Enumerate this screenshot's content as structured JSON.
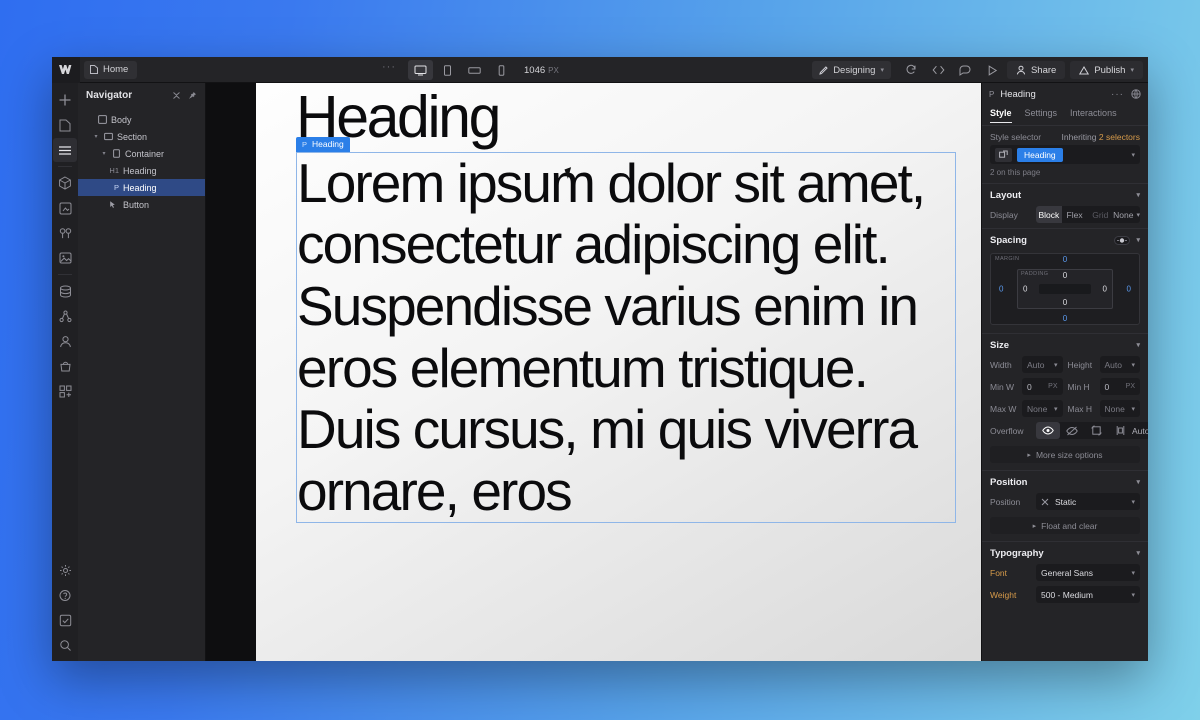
{
  "topbar": {
    "logo": "W",
    "page_tab": "Home",
    "overflow_dots": "···",
    "viewport_icons": [
      "desktop-icon",
      "tablet-icon",
      "mobile-landscape-icon",
      "mobile-portrait-icon"
    ],
    "viewport_width": "1046",
    "viewport_unit": "PX",
    "mode_label": "Designing",
    "actions": [
      "refresh-icon",
      "code-icon",
      "comment-icon",
      "preview-icon"
    ],
    "share_label": "Share",
    "publish_label": "Publish"
  },
  "rail": {
    "icons": [
      "add-icon",
      "pages-icon",
      "navigator-icon",
      "components-icon",
      "assets-icon",
      "variables-icon",
      "media-icon",
      "cms-icon",
      "logic-icon",
      "users-icon",
      "ecommerce-icon",
      "apps-icon"
    ],
    "bottom_icons": [
      "settings-icon",
      "help-icon",
      "audit-icon",
      "search-icon"
    ]
  },
  "navigator": {
    "title": "Navigator",
    "tools": [
      "collapse-icon",
      "pin-icon"
    ],
    "tree": [
      {
        "tag": "",
        "label": "Body",
        "depth": 0,
        "caret": "",
        "selected": false
      },
      {
        "tag": "",
        "label": "Section",
        "depth": 1,
        "caret": "▾",
        "selected": false
      },
      {
        "tag": "",
        "label": "Container",
        "depth": 2,
        "caret": "▾",
        "selected": false
      },
      {
        "tag": "H1",
        "label": "Heading",
        "depth": 3,
        "caret": "",
        "selected": false
      },
      {
        "tag": "P",
        "label": "Heading",
        "depth": 3,
        "caret": "",
        "selected": true
      },
      {
        "tag": "",
        "label": "Button",
        "depth": 3,
        "caret": "",
        "selected": false
      }
    ]
  },
  "canvas": {
    "heading": "Heading",
    "paragraph": "Lorem ipsum dolor sit amet, consectetur adipiscing elit. Suspendisse varius enim in eros elementum tristique. Duis cursus, mi quis viverra ornare, eros",
    "selection_badge_tag": "P",
    "selection_badge_label": "Heading",
    "selection_color": "#2b7fe8"
  },
  "right_panel": {
    "element_tag": "P",
    "element_name": "Heading",
    "header_tools": [
      "more-options-icon",
      "component-icon"
    ],
    "tabs": [
      {
        "label": "Style",
        "active": true
      },
      {
        "label": "Settings",
        "active": false
      },
      {
        "label": "Interactions",
        "active": false
      }
    ],
    "style_selector": {
      "label": "Style selector",
      "inheriting_prefix": "Inheriting ",
      "inheriting_count": "2 selectors",
      "class_chip": "Heading",
      "usage": "2 on this page"
    },
    "layout": {
      "title": "Layout",
      "display_label": "Display",
      "display_options": [
        {
          "label": "Block",
          "state": "on"
        },
        {
          "label": "Flex",
          "state": "off"
        },
        {
          "label": "Grid",
          "state": "dim"
        },
        {
          "label": "None",
          "state": "off"
        }
      ]
    },
    "spacing": {
      "title": "Spacing",
      "margin_label": "MARGIN",
      "padding_label": "PADDING",
      "margin": {
        "top": "0",
        "right": "0",
        "bottom": "0",
        "left": "0"
      },
      "padding": {
        "top": "0",
        "right": "0",
        "bottom": "0",
        "left": "0"
      }
    },
    "size": {
      "title": "Size",
      "width_label": "Width",
      "width_value": "Auto",
      "height_label": "Height",
      "height_value": "Auto",
      "minw_label": "Min W",
      "minw_value": "0",
      "minw_unit": "PX",
      "minh_label": "Min H",
      "minh_value": "0",
      "minh_unit": "PX",
      "maxw_label": "Max W",
      "maxw_value": "None",
      "maxh_label": "Max H",
      "maxh_value": "None",
      "overflow_label": "Overflow",
      "overflow_icons": [
        "visible-icon",
        "hidden-icon",
        "scroll-icon",
        "clip-icon"
      ],
      "overflow_value": "Auto",
      "more_label": "More size options"
    },
    "position": {
      "title": "Position",
      "label": "Position",
      "value": "Static",
      "float_label": "Float and clear"
    },
    "typography": {
      "title": "Typography",
      "font_label": "Font",
      "font_value": "General Sans",
      "weight_label": "Weight",
      "weight_value": "500 - Medium"
    }
  }
}
